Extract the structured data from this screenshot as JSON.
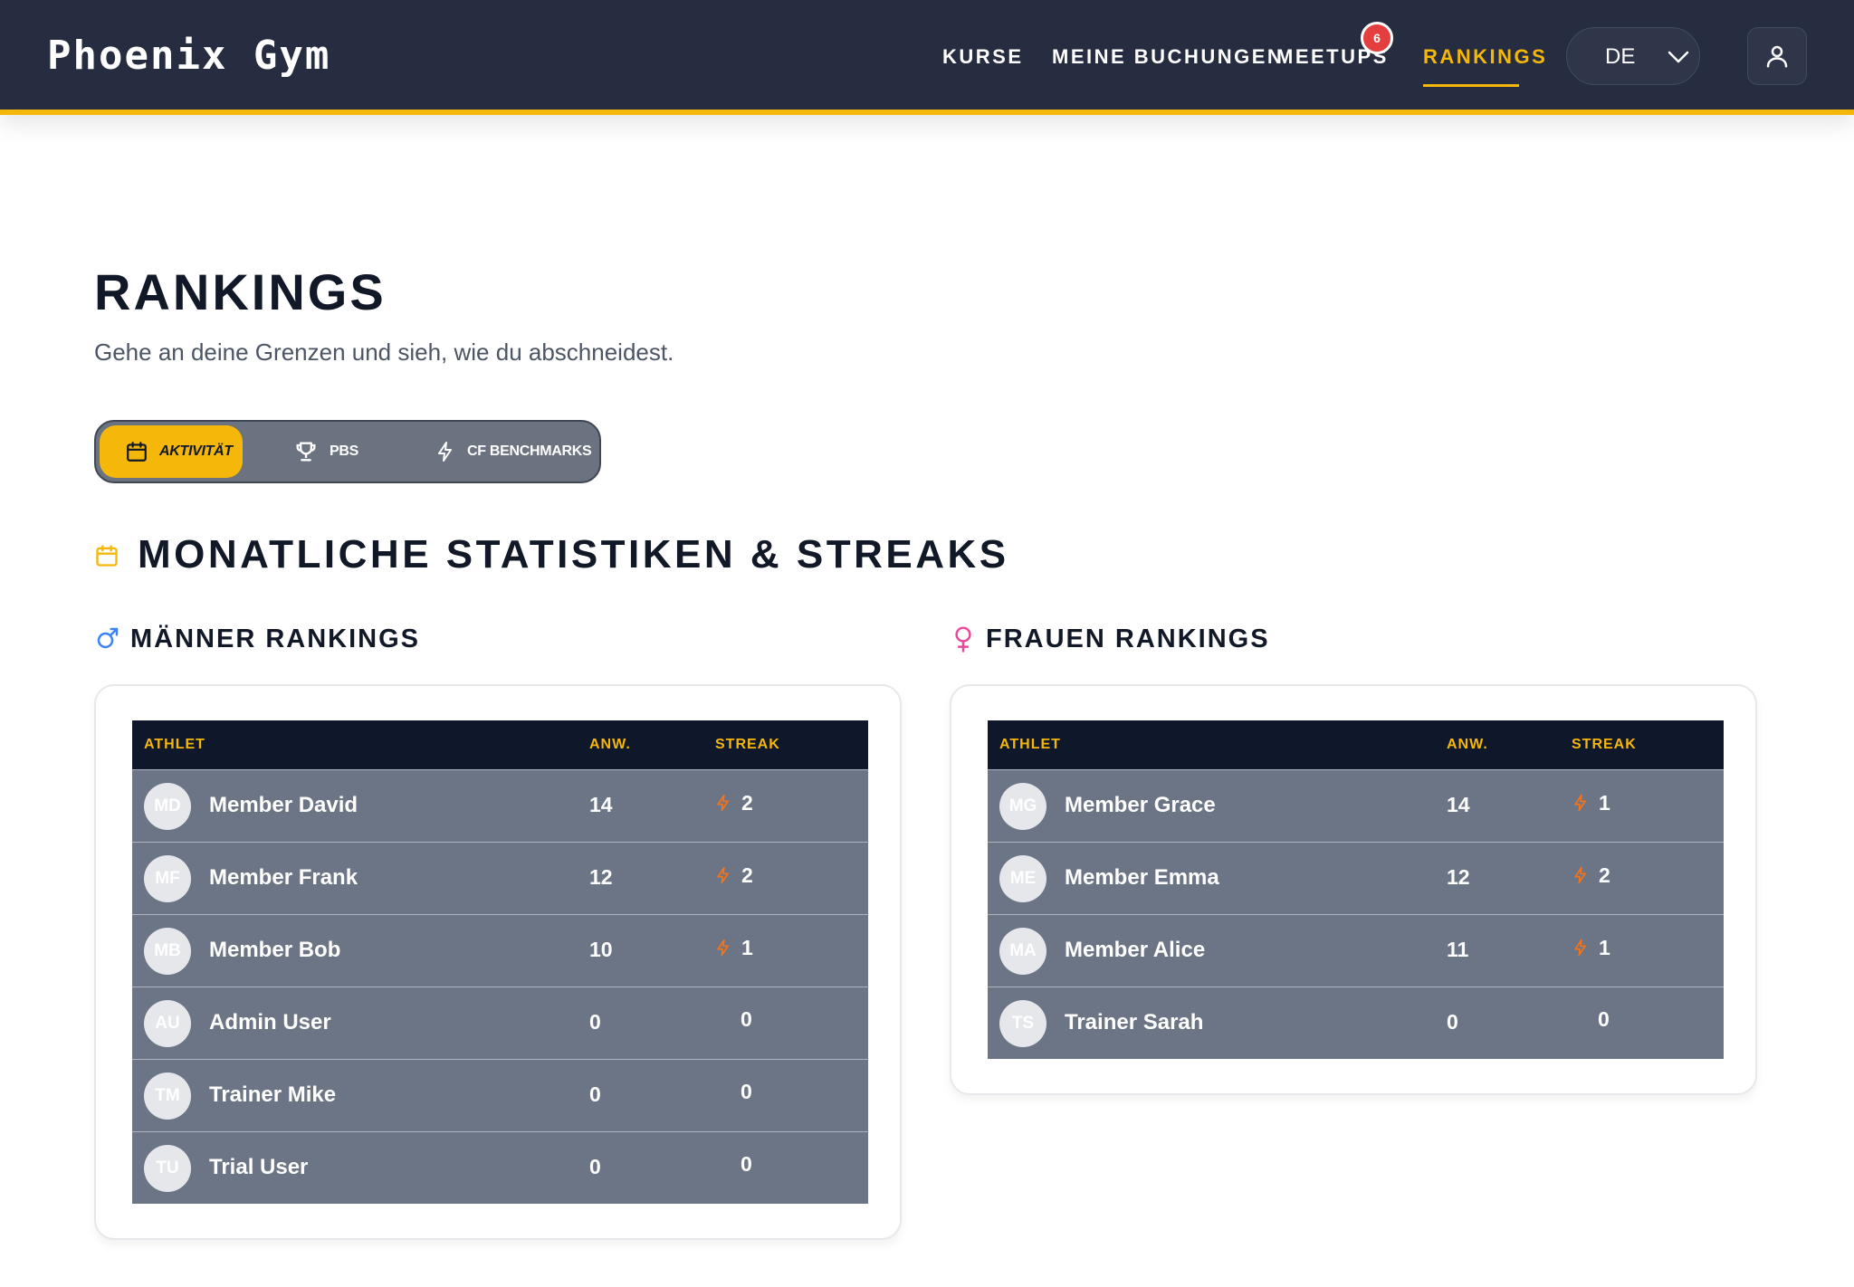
{
  "header": {
    "logo": "Phoenix Gym",
    "nav": [
      {
        "label": "KURSE"
      },
      {
        "label": "MEINE BUCHUNGEN"
      },
      {
        "label": "MEETUPS"
      },
      {
        "label": "RANKINGS"
      }
    ],
    "meetups_badge": "6",
    "language": "DE"
  },
  "page": {
    "title": "RANKINGS",
    "subtitle": "Gehe an deine Grenzen und sieh, wie du abschneidest."
  },
  "tabs": [
    {
      "label": "AKTIVITÄT",
      "icon": "calendar-icon",
      "active": true
    },
    {
      "label": "PBS",
      "icon": "trophy-icon",
      "active": false
    },
    {
      "label": "CF BENCHMARKS",
      "icon": "lightning-icon",
      "active": false
    }
  ],
  "section": {
    "title": "MONATLICHE STATISTIKEN & STREAKS",
    "icon": "calendar-icon"
  },
  "columns": {
    "athlete": "ATHLET",
    "attendance": "ANW.",
    "streak": "STREAK"
  },
  "men": {
    "title": "MÄNNER RANKINGS",
    "icon": "male-icon",
    "rows": [
      {
        "initials": "MD",
        "name": "Member David",
        "attendance": "14",
        "streak": "2",
        "has_streak": true
      },
      {
        "initials": "MF",
        "name": "Member Frank",
        "attendance": "12",
        "streak": "2",
        "has_streak": true
      },
      {
        "initials": "MB",
        "name": "Member Bob",
        "attendance": "10",
        "streak": "1",
        "has_streak": true
      },
      {
        "initials": "AU",
        "name": "Admin User",
        "attendance": "0",
        "streak": "0",
        "has_streak": false
      },
      {
        "initials": "TM",
        "name": "Trainer Mike",
        "attendance": "0",
        "streak": "0",
        "has_streak": false
      },
      {
        "initials": "TU",
        "name": "Trial User",
        "attendance": "0",
        "streak": "0",
        "has_streak": false
      }
    ]
  },
  "women": {
    "title": "FRAUEN RANKINGS",
    "icon": "female-icon",
    "rows": [
      {
        "initials": "MG",
        "name": "Member Grace",
        "attendance": "14",
        "streak": "1",
        "has_streak": true
      },
      {
        "initials": "ME",
        "name": "Member Emma",
        "attendance": "12",
        "streak": "2",
        "has_streak": true
      },
      {
        "initials": "MA",
        "name": "Member Alice",
        "attendance": "11",
        "streak": "1",
        "has_streak": true
      },
      {
        "initials": "TS",
        "name": "Trainer Sarah",
        "attendance": "0",
        "streak": "0",
        "has_streak": false
      }
    ]
  },
  "colors": {
    "header_bg": "#262d40",
    "accent": "#f5b70a",
    "table_head": "#0f172a",
    "row_bg": "#6b7585",
    "flame": "#f97316",
    "male": "#3b82f6",
    "female": "#ec4899",
    "badge": "#e53e3e"
  }
}
